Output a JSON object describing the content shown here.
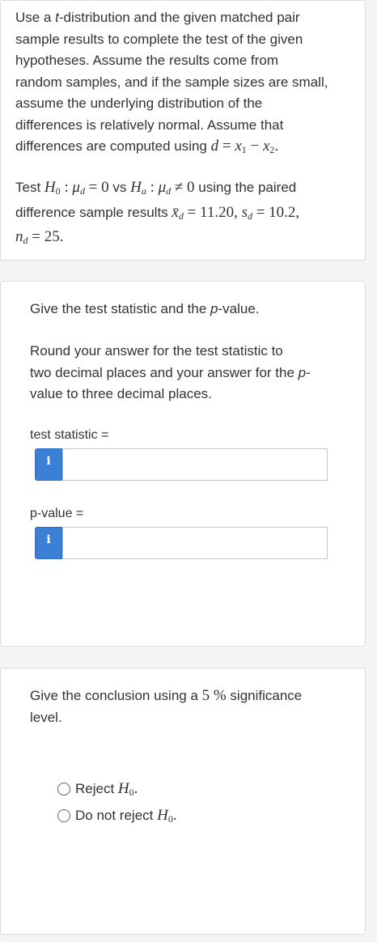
{
  "question": {
    "line1": "Use a t-distribution and the given matched pair",
    "line2": "sample results to complete the test of the given",
    "line3": "hypotheses. Assume the results come from",
    "line4": "random samples, and if the sample sizes are small,",
    "line5": "assume the underlying distribution of the",
    "line6": "differences is relatively normal. Assume that",
    "line7": "differences are computed using d = x1 − x2.",
    "hyp_line1": "Test H0 : μd = 0 vs Ha : μd ≠ 0 using the paired",
    "hyp_line2": "difference sample results x̄d = 11.20, sd = 10.2,",
    "hyp_line3": "nd = 25."
  },
  "part1": {
    "prompt": "Give the test statistic and the p-value.",
    "round_line1": "Round your answer for the test statistic to",
    "round_line2": "two decimal places and your answer for the p-",
    "round_line3": "value to three decimal places.",
    "test_statistic_label": "test statistic =",
    "test_statistic_value": "",
    "p_value_label": "p-value =",
    "p_value_value": "",
    "info_glyph": "i"
  },
  "part2": {
    "prompt_line1": "Give the conclusion using a 5 % significance",
    "prompt_line2": "level.",
    "options": [
      "Reject H0.",
      "Do not reject H0."
    ]
  }
}
